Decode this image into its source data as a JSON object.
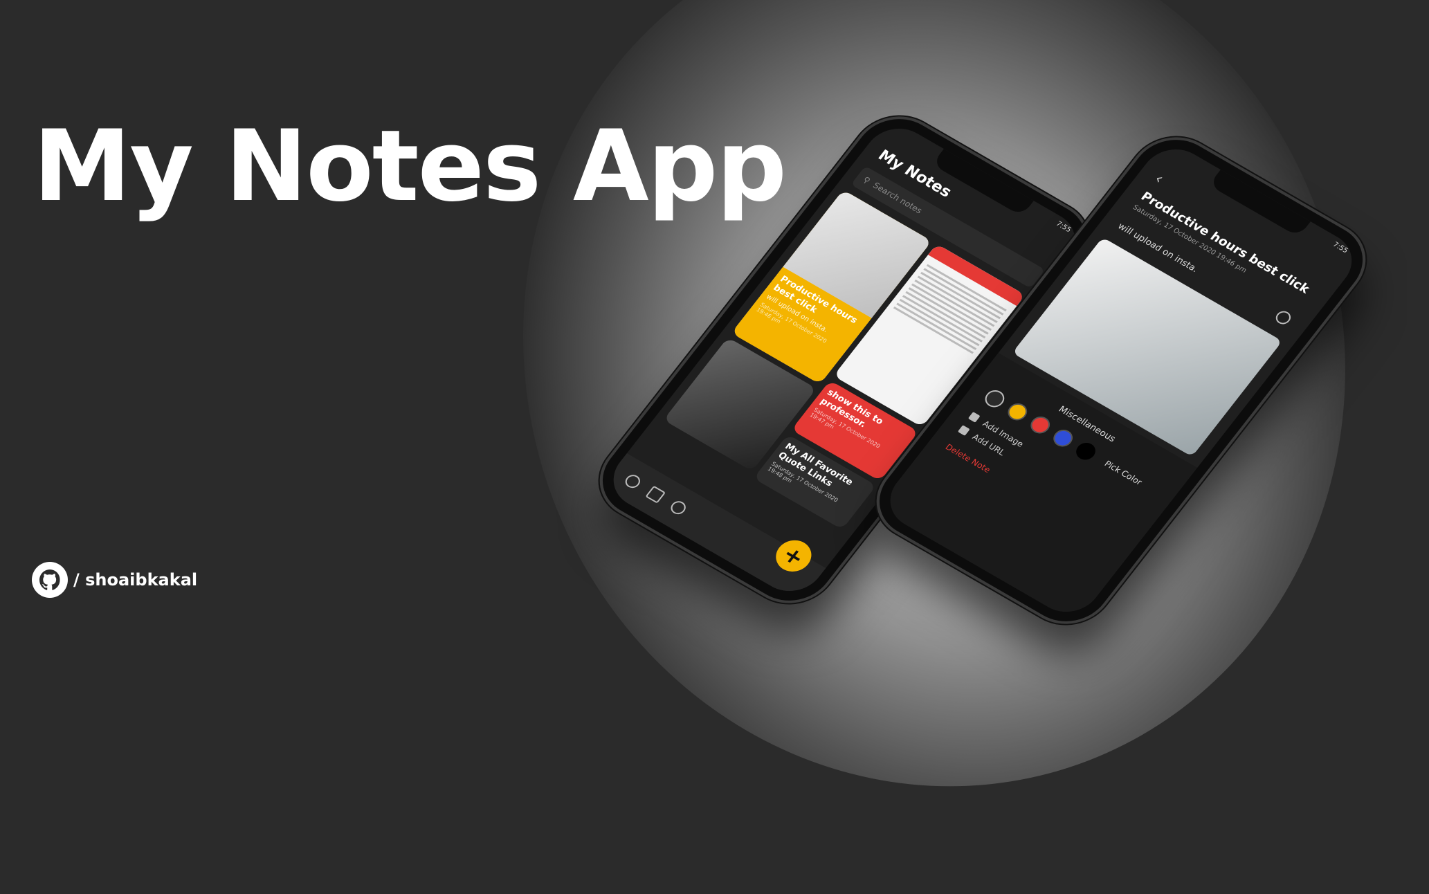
{
  "hero": {
    "title": "My Notes App"
  },
  "github": {
    "handle": "/ shoaibkakal"
  },
  "left_phone": {
    "status_time": "7:55",
    "app_title": "My Notes",
    "search_placeholder": "Search notes",
    "notes": [
      {
        "title": "Productive hours best click",
        "subtitle": "will upload on insta.",
        "date": "Saturday, 17 October 2020 19:46 pm"
      },
      {
        "title": "show this to professor.",
        "subtitle": "",
        "date": "Saturday, 17 October 2020 19:47 pm"
      },
      {
        "title": "My All Favorite Quote Links",
        "subtitle": "",
        "date": "Saturday, 17 October 2020 19:48 pm"
      }
    ],
    "fab_label": "+"
  },
  "right_phone": {
    "status_time": "7:55",
    "back_label": "‹",
    "note_title": "Productive hours best click",
    "note_date": "Saturday, 17 October 2020 19:46 pm",
    "note_body": "will upload on insta.",
    "sheet_title": "Miscellaneous",
    "pick_color": "Pick Color",
    "options": [
      "Add Image",
      "Add URL"
    ],
    "delete_label": "Delete Note",
    "colors": [
      "#2b2b2b",
      "#f4b400",
      "#e53935",
      "#2f4ed8",
      "#000000"
    ]
  }
}
